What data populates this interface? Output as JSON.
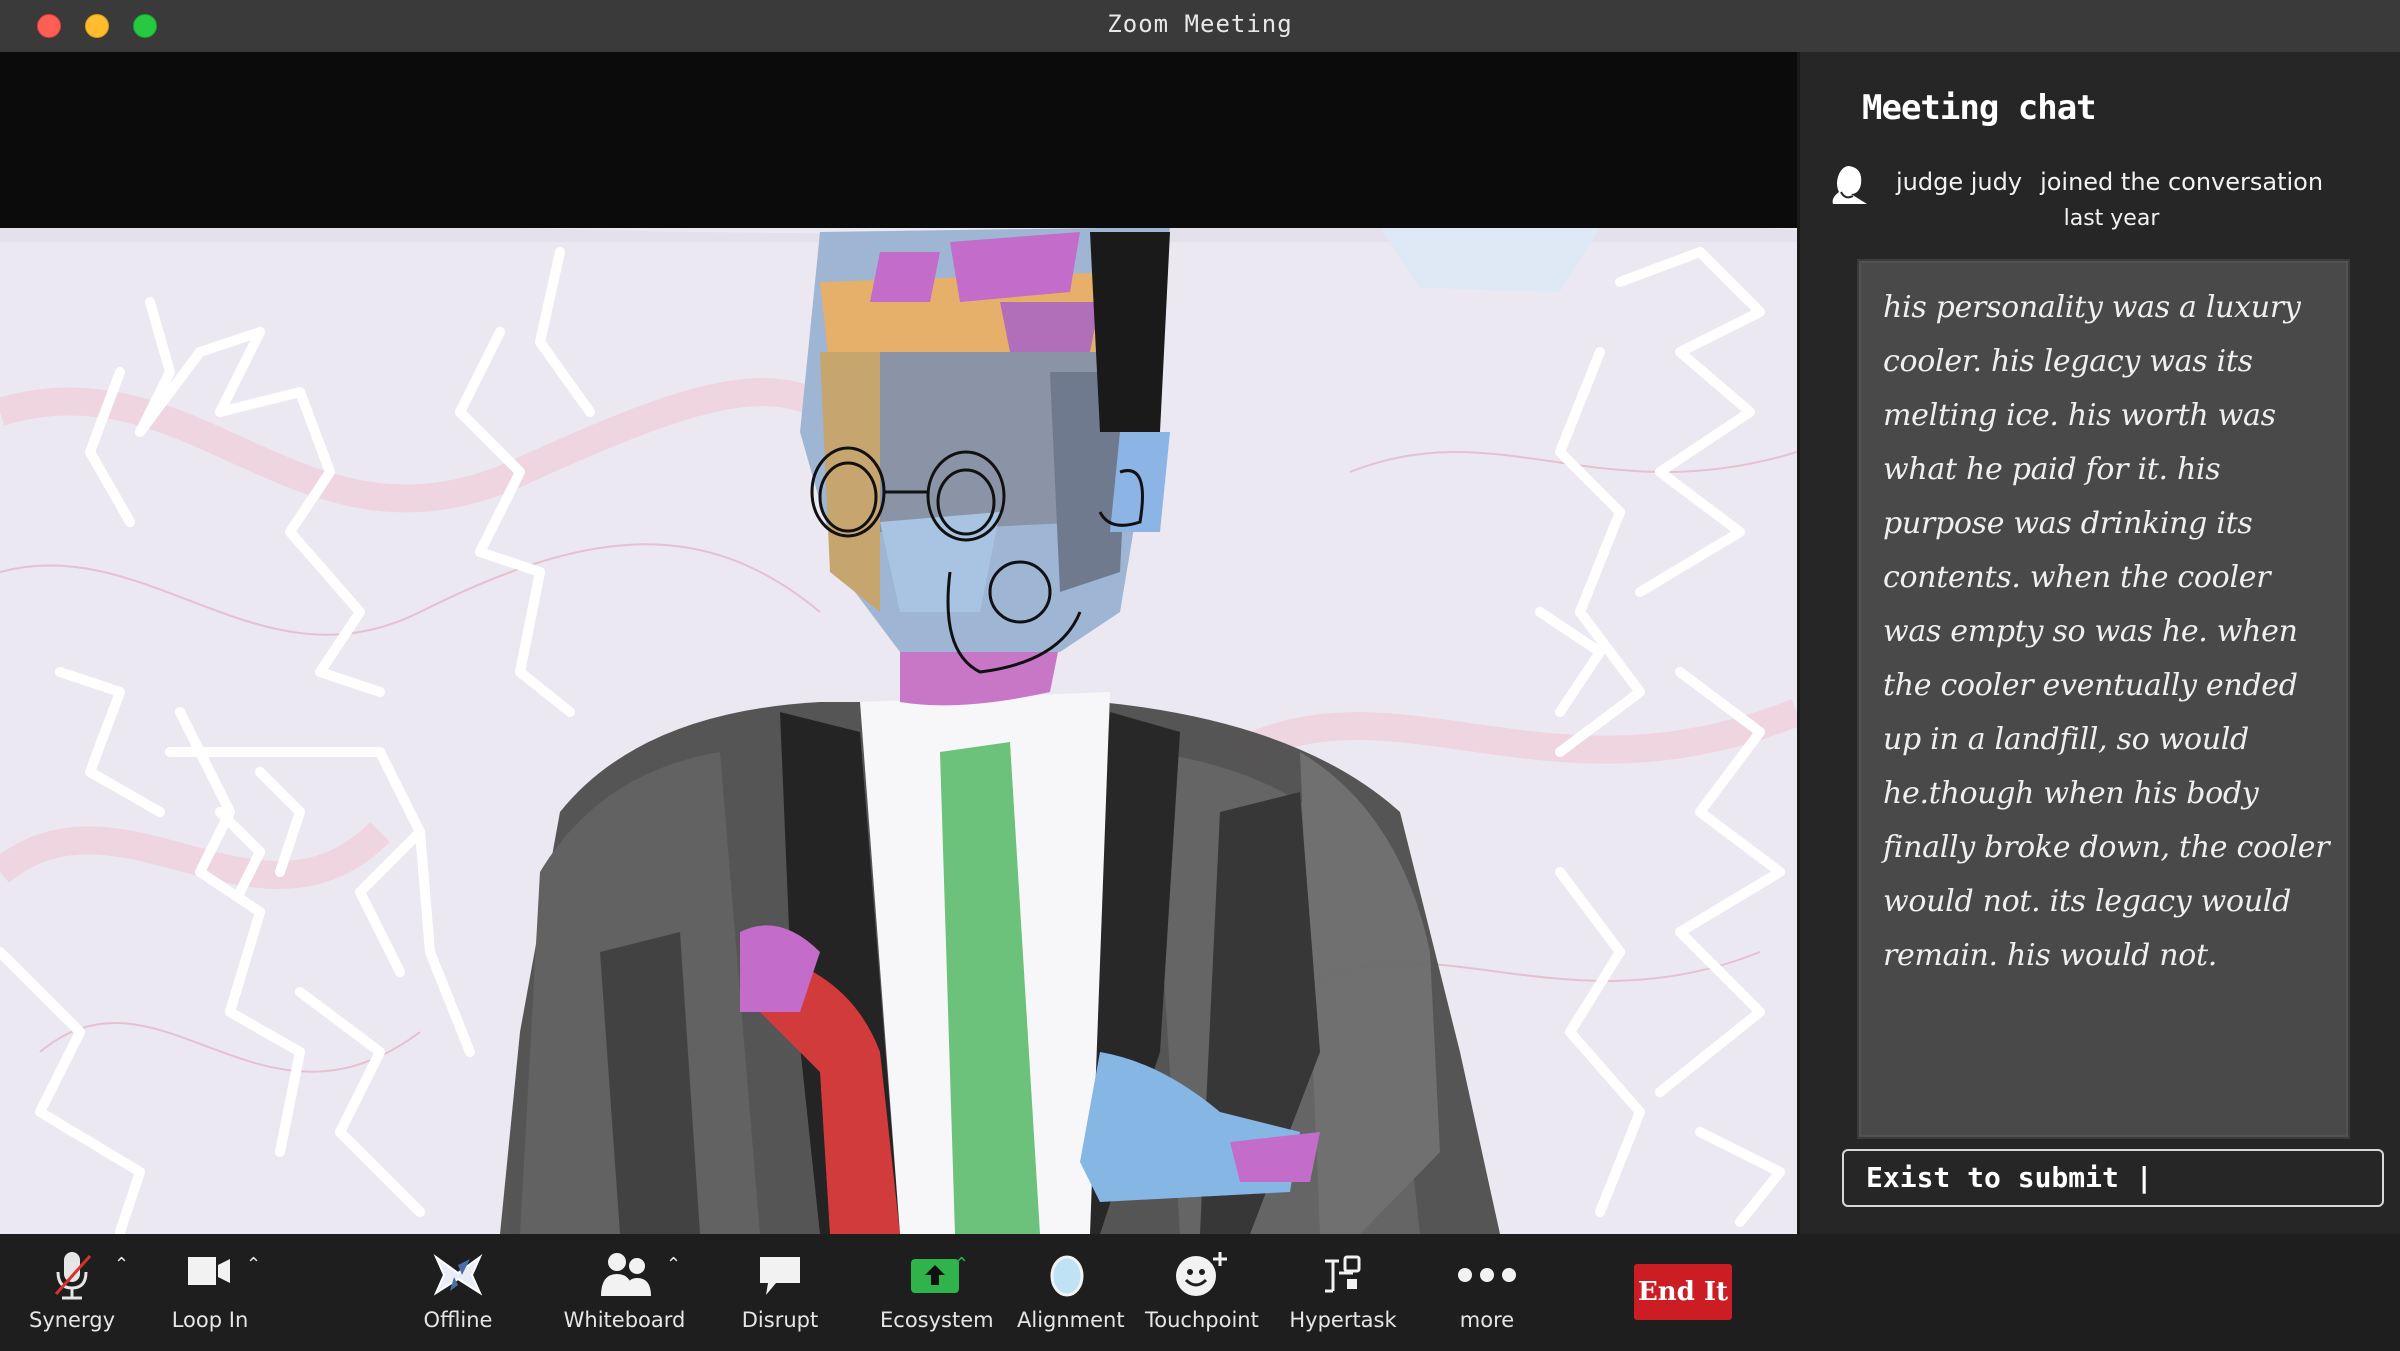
{
  "window": {
    "title": "Zoom Meeting"
  },
  "chat": {
    "heading": "Meeting chat",
    "notice": {
      "user": "judge judy",
      "action": "joined the conversation",
      "time": "last year"
    },
    "message": "his personality was a luxury cooler. his legacy was its melting ice. his worth was what he paid for it. his purpose was drinking its contents. when the cooler was empty so was he. when the cooler eventually ended up in a landfill, so would he.though when his body finally broke down, the cooler would not. its legacy would remain. his would not.",
    "input_value": "Exist to submit |"
  },
  "toolbar": {
    "items": [
      {
        "label": "Synergy",
        "icon": "microphone-muted-icon"
      },
      {
        "label": "Loop In",
        "icon": "video-camera-icon"
      },
      {
        "label": "Offline",
        "icon": "bowtie-icon"
      },
      {
        "label": "Whiteboard",
        "icon": "participants-icon"
      },
      {
        "label": "Disrupt",
        "icon": "speech-bubble-icon"
      },
      {
        "label": "Ecosystem",
        "icon": "share-screen-icon"
      },
      {
        "label": "Alignment",
        "icon": "egg-icon"
      },
      {
        "label": "Touchpoint",
        "icon": "smiley-plus-icon"
      },
      {
        "label": "Hypertask",
        "icon": "apps-icon"
      },
      {
        "label": "more",
        "icon": "more-dots-icon"
      }
    ],
    "end_label": "End It"
  },
  "colors": {
    "end_button": "#cc1d25",
    "share_green": "#2fb34a"
  }
}
